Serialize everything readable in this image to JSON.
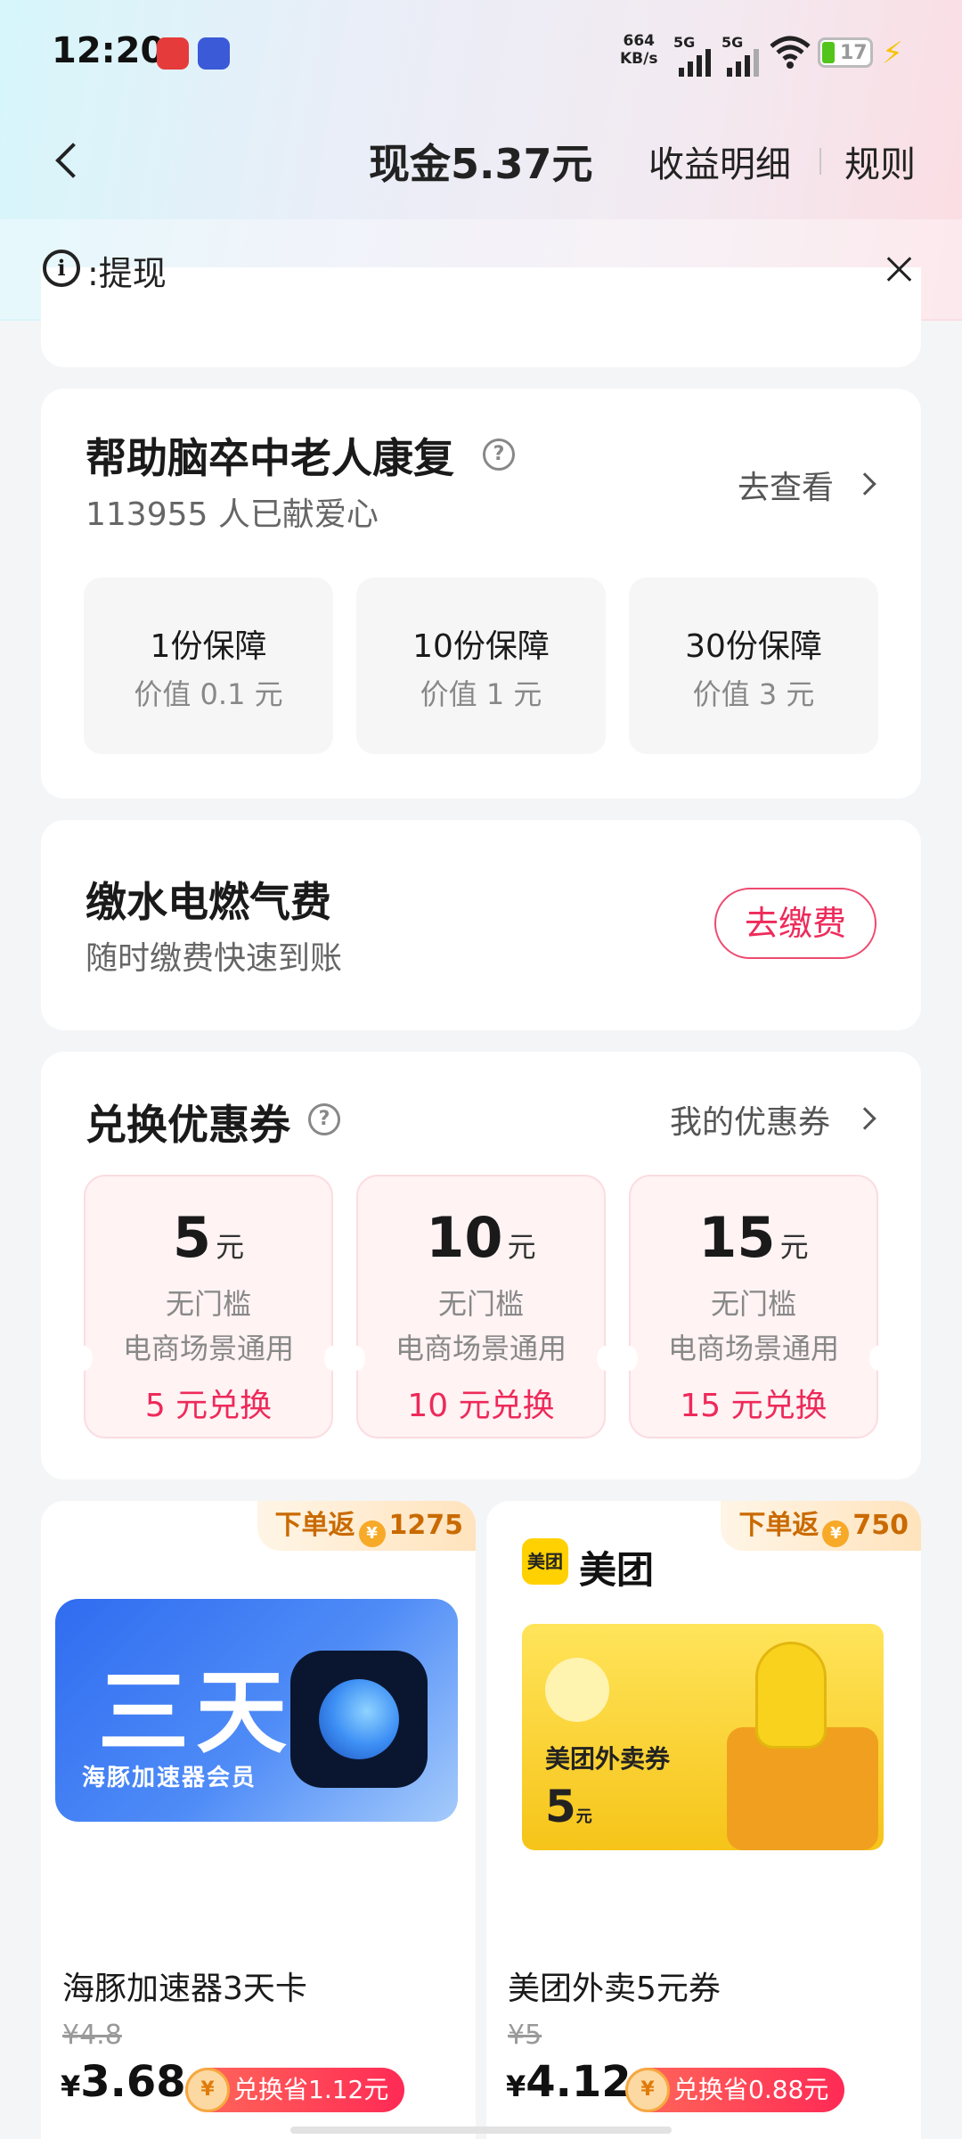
{
  "status_bar": {
    "time": "12:20",
    "net_speed_value": "664",
    "net_speed_unit": "KB/s",
    "sim1": "5G",
    "sim2": "5G",
    "battery": "17"
  },
  "header": {
    "balance": "现金5.37元",
    "earnings_link": "收益明细",
    "rules_link": "规则"
  },
  "notice": {
    "text": ":提现"
  },
  "charity": {
    "title": "帮助脑卒中老人康复",
    "donors": "113955 人已献爱心",
    "view_link": "去查看",
    "packages": [
      {
        "title": "1份保障",
        "value": "价值 0.1 元"
      },
      {
        "title": "10份保障",
        "value": "价值 1 元"
      },
      {
        "title": "30份保障",
        "value": "价值 3 元"
      }
    ]
  },
  "utilities": {
    "title": "缴水电燃气费",
    "subtitle": "随时缴费快速到账",
    "button": "去缴费"
  },
  "coupons": {
    "title": "兑换优惠券",
    "my_link": "我的优惠券",
    "items": [
      {
        "amount": "5",
        "unit": "元",
        "line1": "无门槛",
        "line2": "电商场景通用",
        "exchange": "5 元兑换"
      },
      {
        "amount": "10",
        "unit": "元",
        "line1": "无门槛",
        "line2": "电商场景通用",
        "exchange": "10 元兑换"
      },
      {
        "amount": "15",
        "unit": "元",
        "line1": "无门槛",
        "line2": "电商场景通用",
        "exchange": "15 元兑换"
      }
    ]
  },
  "products": [
    {
      "cashback_label": "下单返",
      "cashback_amount": "1275",
      "image_big": "三天",
      "image_small": "海豚加速器会员",
      "name": "海豚加速器3天卡",
      "old_price": "¥4.8",
      "currency": "¥",
      "price": "3.68",
      "save": "兑换省1.12元"
    },
    {
      "cashback_label": "下单返",
      "cashback_amount": "750",
      "brand_logo": "美团",
      "brand_name": "美团",
      "image_label": "美团外卖券",
      "image_value": "5",
      "image_unit": "元",
      "name": "美团外卖5元券",
      "old_price": "¥5",
      "currency": "¥",
      "price": "4.12",
      "save": "兑换省0.88元"
    }
  ],
  "colors": {
    "accent": "#ee2a5a",
    "coupon_bg": "#fff3f4",
    "cashback_text": "#c96a00"
  }
}
